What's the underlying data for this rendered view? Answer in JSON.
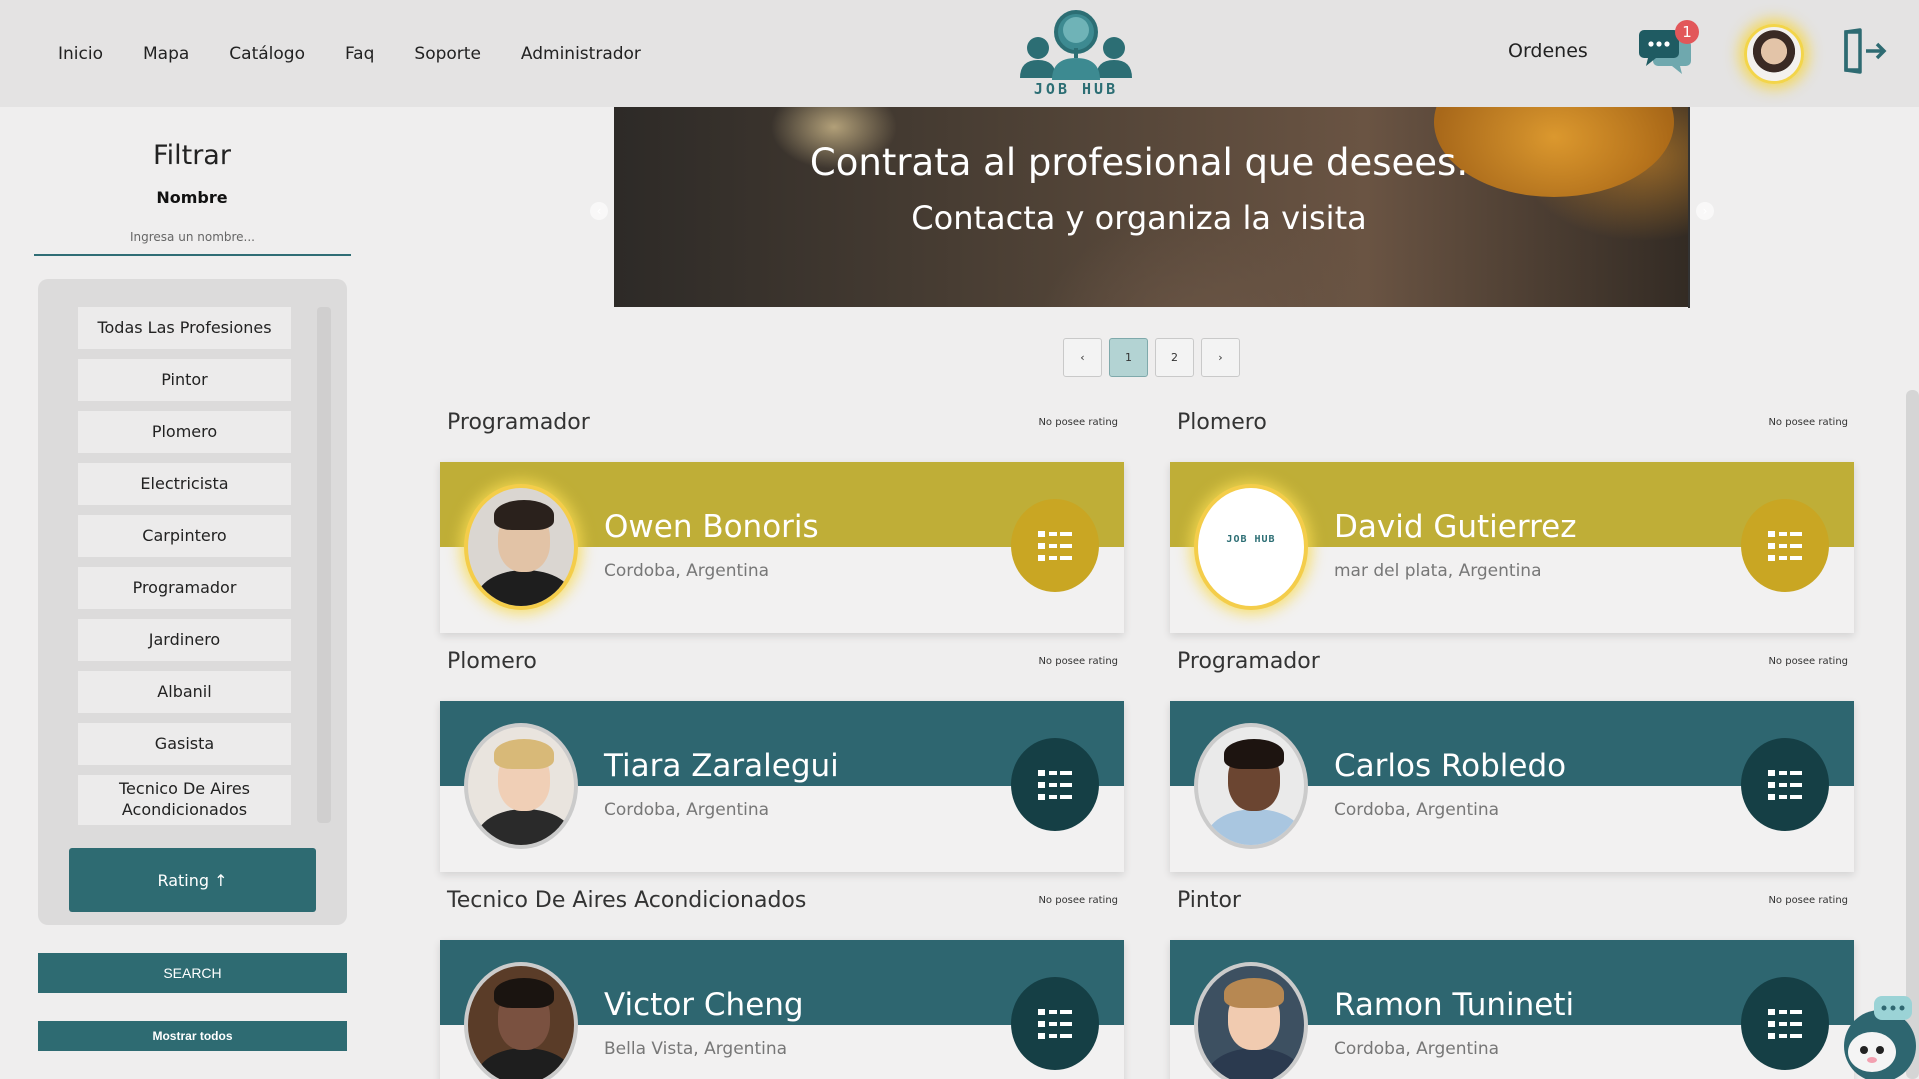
{
  "nav": {
    "links": [
      "Inicio",
      "Mapa",
      "Catálogo",
      "Faq",
      "Soporte",
      "Administrador"
    ],
    "logo_text": "JOB HUB",
    "orders": "Ordenes",
    "chat_badge": "1"
  },
  "sidebar": {
    "title": "Filtrar",
    "name_label": "Nombre",
    "name_placeholder": "Ingresa un nombre...",
    "professions": [
      "Todas Las Profesiones",
      "Pintor",
      "Plomero",
      "Electricista",
      "Carpintero",
      "Programador",
      "Jardinero",
      "Albanil",
      "Gasista",
      "Tecnico De Aires Acondicionados"
    ],
    "rating_button": "Rating ↑",
    "search_button": "SEARCH",
    "show_all_button": "Mostrar todos"
  },
  "banner": {
    "title": "Contrata al profesional que desees.",
    "subtitle": "Contacta y organiza la visita"
  },
  "pagination": {
    "prev": "‹",
    "pages": [
      "1",
      "2"
    ],
    "next": "›",
    "active": "1"
  },
  "cards": [
    {
      "profession": "Programador",
      "rating": "No posee rating",
      "name": "Owen Bonoris",
      "location": "Cordoba, Argentina",
      "theme": "gold",
      "avatar_logo": ""
    },
    {
      "profession": "Plomero",
      "rating": "No posee rating",
      "name": "David Gutierrez",
      "location": "mar del plata, Argentina",
      "theme": "gold",
      "avatar_logo": "JOB HUB"
    },
    {
      "profession": "Plomero",
      "rating": "No posee rating",
      "name": "Tiara Zaralegui",
      "location": "Cordoba, Argentina",
      "theme": "teal",
      "avatar_logo": ""
    },
    {
      "profession": "Programador",
      "rating": "No posee rating",
      "name": "Carlos Robledo",
      "location": "Cordoba, Argentina",
      "theme": "teal",
      "avatar_logo": ""
    },
    {
      "profession": "Tecnico De Aires Acondicionados",
      "rating": "No posee rating",
      "name": "Victor Cheng",
      "location": "Bella Vista, Argentina",
      "theme": "teal",
      "avatar_logo": ""
    },
    {
      "profession": "Pintor",
      "rating": "No posee rating",
      "name": "Ramon Tunineti",
      "location": "Cordoba, Argentina",
      "theme": "teal",
      "avatar_logo": ""
    }
  ],
  "colors": {
    "teal": "#2e6b72",
    "gold": "#bfae37",
    "badge": "#e2575a"
  }
}
